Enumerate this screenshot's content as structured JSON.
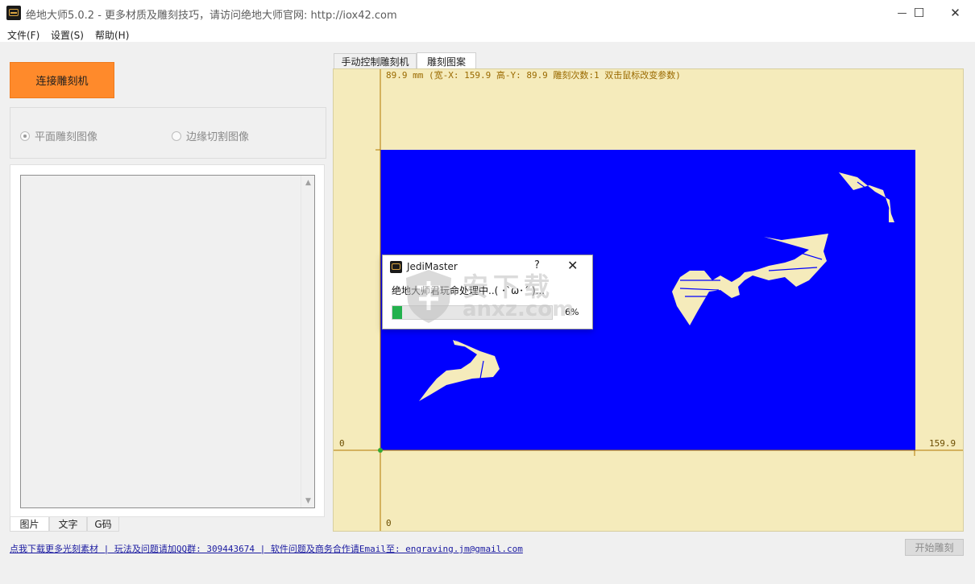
{
  "window": {
    "title": "绝地大师5.0.2 - 更多材质及雕刻技巧，请访问绝地大师官网: http://iox42.com",
    "minimize_glyph": "—",
    "maximize_glyph": "☐",
    "close_glyph": "✕"
  },
  "menu": {
    "file": "文件(F)",
    "settings": "设置(S)",
    "help": "帮助(H)"
  },
  "left": {
    "connect_button": "连接雕刻机",
    "mode_flat": "平面雕刻图像",
    "mode_edge": "边缘切割图像",
    "mode_selected": "flat",
    "tabs": [
      "图片",
      "文字",
      "G码"
    ]
  },
  "right": {
    "tabs": [
      "手动控制雕刻机",
      "雕刻图案"
    ],
    "active_tab": 1,
    "info_line": "89.9 mm  (宽-X: 159.9  高-Y: 89.9  雕刻次数:1  双击鼠标改变参数)",
    "axis_origin_y": "0",
    "axis_origin_x": "0",
    "axis_max_x": "159.9",
    "colors": {
      "canvas_bg": "#f5ebbb",
      "work_area": "#0000ff",
      "axis": "#b37a00",
      "info_text": "#9a6a00"
    }
  },
  "dialog": {
    "title": "JediMaster",
    "help": "?",
    "close": "✕",
    "message": "绝地大师君玩命处理中..( ･`ω･´ )...",
    "percent_text": "6%",
    "progress": 0.06
  },
  "watermark": {
    "top": "安下载",
    "bottom": "anxz.com"
  },
  "footer": {
    "link_text": "点我下载更多光刻素材 | 玩法及问题请加QQ群: 309443674 | 软件问题及商务合作请Email至: engraving.jm@gmail.com",
    "start_button": "开始雕刻"
  }
}
